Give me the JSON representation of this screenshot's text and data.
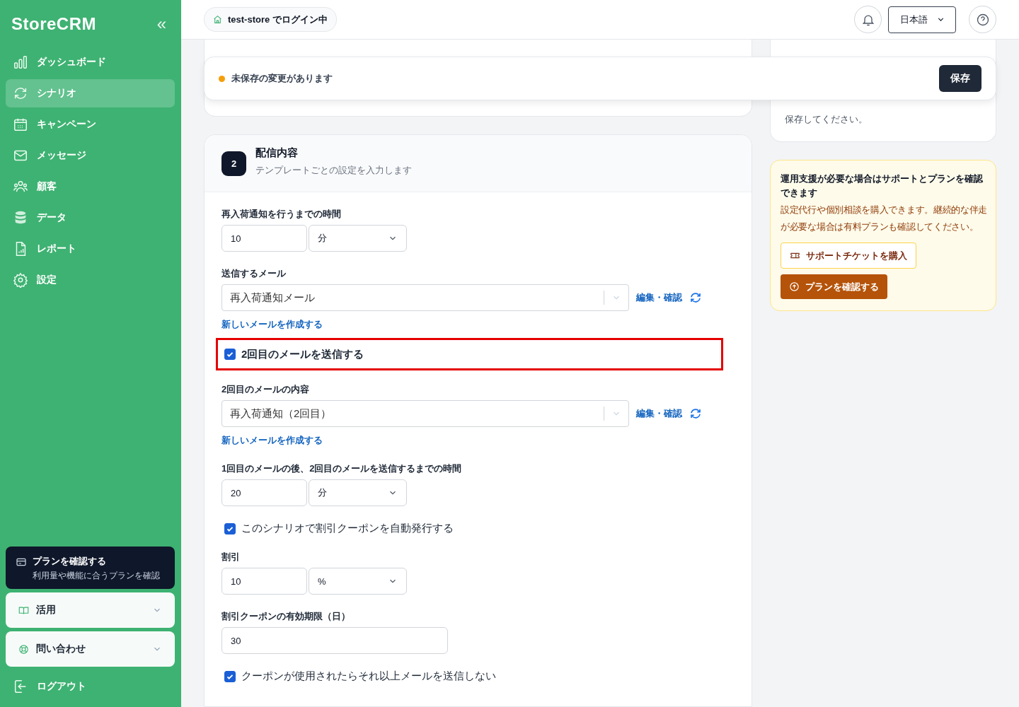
{
  "sidebar": {
    "logo": "StoreCRM",
    "collapse_icon": "«",
    "items": [
      {
        "label": "ダッシュボード",
        "selected": false
      },
      {
        "label": "シナリオ",
        "selected": true
      },
      {
        "label": "キャンペーン",
        "selected": false
      },
      {
        "label": "メッセージ",
        "selected": false
      },
      {
        "label": "顧客",
        "selected": false
      },
      {
        "label": "データ",
        "selected": false
      },
      {
        "label": "レポート",
        "selected": false
      },
      {
        "label": "設定",
        "selected": false
      }
    ],
    "plan_card": {
      "title": "プランを確認する",
      "subtitle": "利用量や機能に合うプランを確認"
    },
    "accordions": [
      {
        "label": "活用",
        "expanded": false
      },
      {
        "label": "問い合わせ",
        "expanded": false
      }
    ],
    "logout": "ログアウト"
  },
  "topbar": {
    "store_badge": "test-store でログイン中",
    "language": "日本語"
  },
  "unsaved_bar": {
    "message": "未保存の変更があります",
    "save_button": "保存"
  },
  "section": {
    "number": "2",
    "title": "配信内容",
    "subtitle": "テンプレートごとの設定を入力します",
    "fields": [
      {
        "kind": "number_unit",
        "label": "再入荷通知を行うまでの時間",
        "value": "10",
        "unit": "分"
      },
      {
        "kind": "select",
        "label": "送信するメール",
        "value": "再入荷通知メール",
        "edit_link": "編集・確認",
        "new_link": "新しいメールを作成する"
      },
      {
        "kind": "checkbox",
        "label": "2回目のメールを送信する",
        "checked": true,
        "highlight": true
      },
      {
        "kind": "select",
        "label": "2回目のメールの内容",
        "value": "再入荷通知（2回目）",
        "edit_link": "編集・確認",
        "new_link": "新しいメールを作成する"
      },
      {
        "kind": "number_unit",
        "label": "1回目のメールの後、2回目のメールを送信するまでの時間",
        "value": "20",
        "unit": "分"
      },
      {
        "kind": "checkbox",
        "label": "このシナリオで割引クーポンを自動発行する",
        "checked": true,
        "highlight": false
      },
      {
        "kind": "number_unit",
        "label": "割引",
        "value": "10",
        "unit": "%"
      },
      {
        "kind": "number",
        "label": "割引クーポンの有効期限（日）",
        "value": "30"
      },
      {
        "kind": "checkbox",
        "label": "クーポンが使用されたらそれ以上メールを送信しない",
        "checked": true,
        "highlight": false
      }
    ]
  },
  "save_card": {
    "text": "保存してください。"
  },
  "support_card": {
    "title": "運用支援が必要な場合はサポートとプランを確認できます",
    "text": "設定代行や個別相談を購入できます。継続的な伴走が必要な場合は有料プランも確認してください。",
    "ticket_button": "サポートチケットを購入",
    "plan_button": "プランを確認する"
  }
}
